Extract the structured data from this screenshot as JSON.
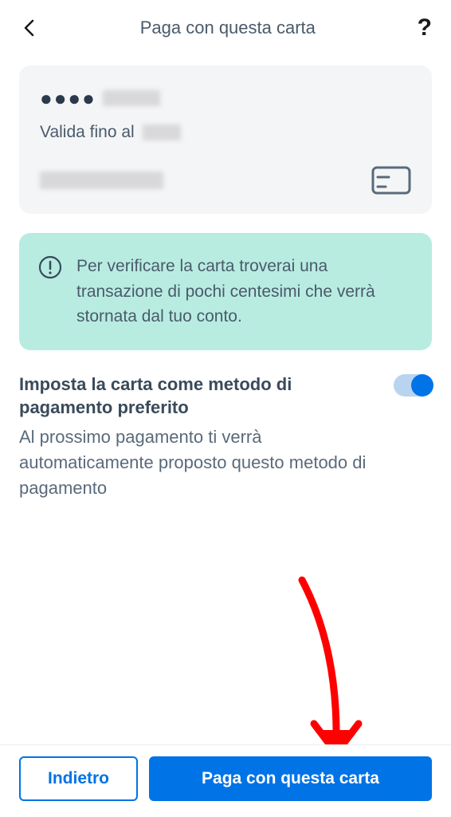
{
  "header": {
    "title": "Paga con questa carta"
  },
  "card": {
    "masked_prefix": "●●●●",
    "valid_label": "Valida fino al"
  },
  "info": {
    "text": "Per verificare la carta troverai una transazione di pochi centesimi che verrà stornata dal tuo conto."
  },
  "toggle": {
    "title": "Imposta la carta come metodo di pagamento preferito",
    "description": "Al prossimo pagamento ti verrà automaticamente proposto questo metodo di pagamento",
    "on": true
  },
  "footer": {
    "back_label": "Indietro",
    "pay_label": "Paga con questa carta"
  },
  "colors": {
    "primary": "#0073e6",
    "info_bg": "#b8ece1",
    "card_bg": "#f4f5f7",
    "annotation": "#ff0000"
  }
}
